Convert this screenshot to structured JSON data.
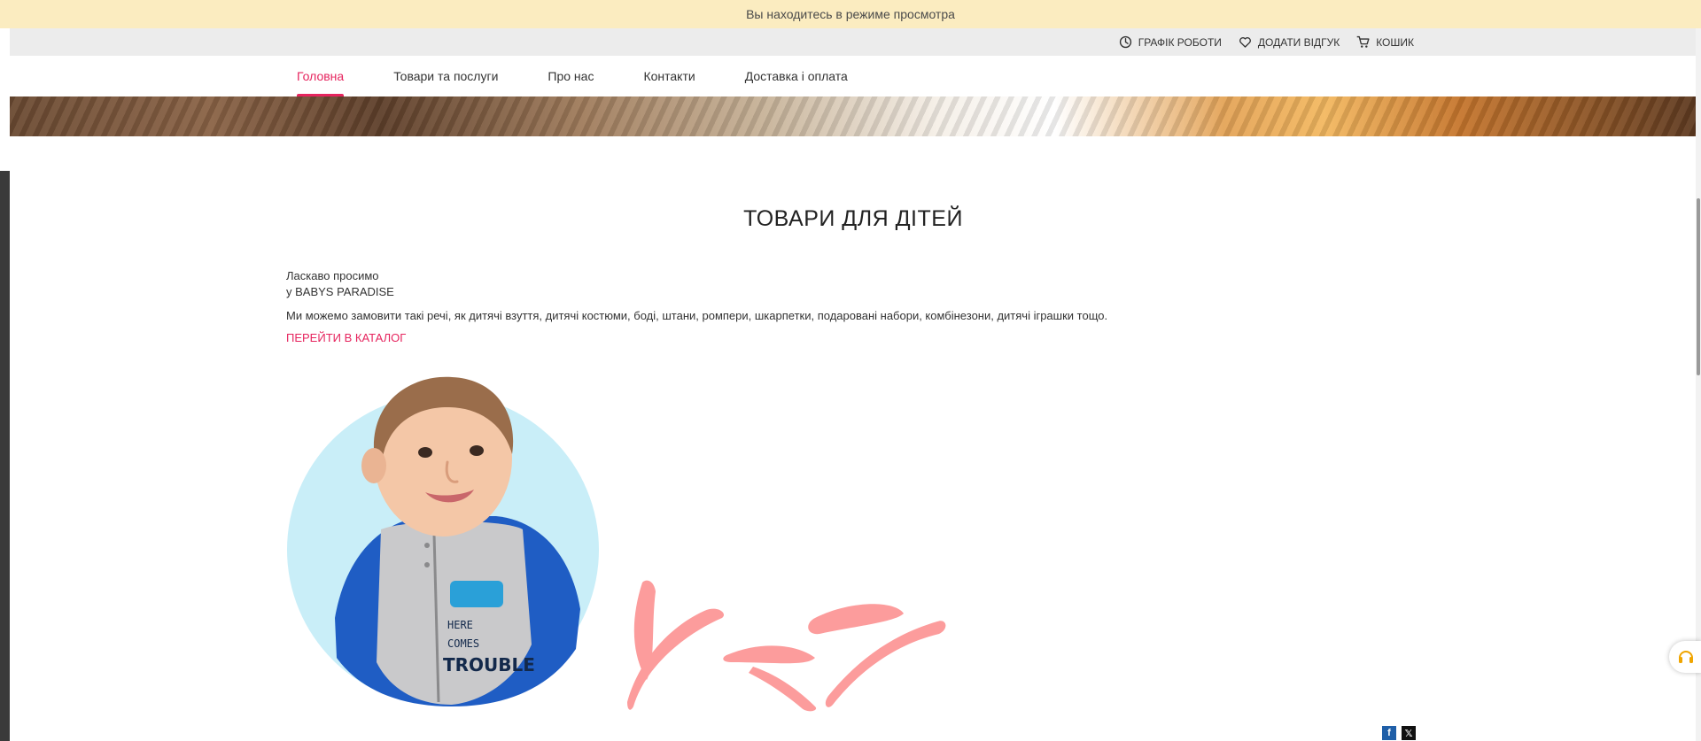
{
  "preview_bar": {
    "text": "Вы находитесь в режиме просмотра"
  },
  "topbar": {
    "links": [
      {
        "label": "ГРАФІК РОБОТИ",
        "icon": "clock-icon"
      },
      {
        "label": "ДОДАТИ ВІДГУК",
        "icon": "heart-icon"
      },
      {
        "label": "КОШИК",
        "icon": "cart-icon"
      }
    ]
  },
  "nav": {
    "items": [
      {
        "label": "Головна",
        "active": true
      },
      {
        "label": "Товари та послуги",
        "active": false
      },
      {
        "label": "Про нас",
        "active": false
      },
      {
        "label": "Контакти",
        "active": false
      },
      {
        "label": "Доставка і оплата",
        "active": false
      }
    ]
  },
  "main": {
    "title": "ТОВАРИ ДЛЯ ДІТЕЙ",
    "welcome_line1": "Ласкаво просимо",
    "welcome_line2": "у BABYS PARADISE",
    "description": "Ми можемо замовити такі речі, як дитячі взуття, дитячі костюми, боді, штани, ромпери, шкарпетки, подаровані набори, комбінезони, дитячі іграшки тощо.",
    "catalog_link": "ПЕРЕЙТИ В КАТАЛОГ",
    "shirt_text_1": "HERE",
    "shirt_text_2": "COMES",
    "shirt_text_3": "TROUBLE"
  },
  "social": [
    {
      "name": "facebook",
      "glyph": "f",
      "color": "#1f5fa8"
    },
    {
      "name": "x",
      "glyph": "𝕏",
      "color": "#111111"
    }
  ],
  "colors": {
    "accent": "#e6245e",
    "preview_bar": "#fbecc0",
    "topbar": "#ececec",
    "circle": "#c9eef8",
    "decor": "#fc9c9c"
  }
}
